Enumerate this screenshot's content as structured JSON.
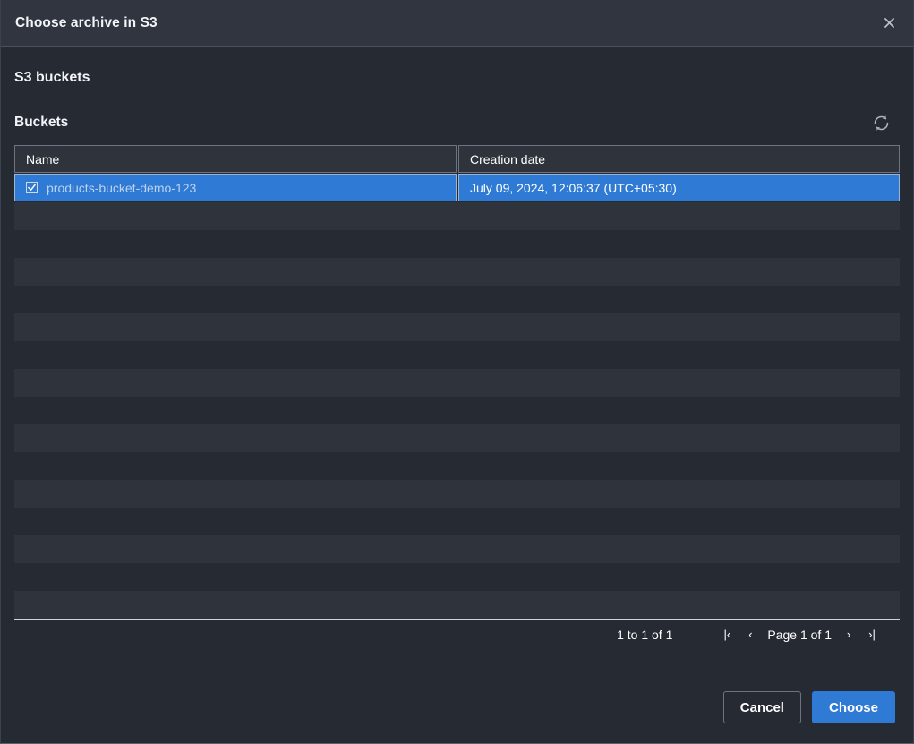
{
  "dialog": {
    "title": "Choose archive in S3",
    "close_icon": "close-icon"
  },
  "section": {
    "heading": "S3 buckets",
    "subheading": "Buckets",
    "refresh_icon": "refresh-icon"
  },
  "table": {
    "columns": [
      "Name",
      "Creation date"
    ],
    "rows": [
      {
        "selected": true,
        "checked": true,
        "name": "products-bucket-demo-123",
        "creation_date": "July 09, 2024, 12:06:37 (UTC+05:30)"
      }
    ],
    "empty_row_count": 7
  },
  "pagination": {
    "count_text": "1 to 1 of 1",
    "first_label": "|‹",
    "prev_label": "‹",
    "page_label": "Page 1 of 1",
    "next_label": "›",
    "last_label": "›|"
  },
  "footer": {
    "cancel_label": "Cancel",
    "choose_label": "Choose"
  },
  "colors": {
    "accent": "#2f7ad4",
    "header_bg": "#30353f",
    "body_bg": "#252a33",
    "row_bg": "#2e333c",
    "link": "#bcd3ef"
  }
}
